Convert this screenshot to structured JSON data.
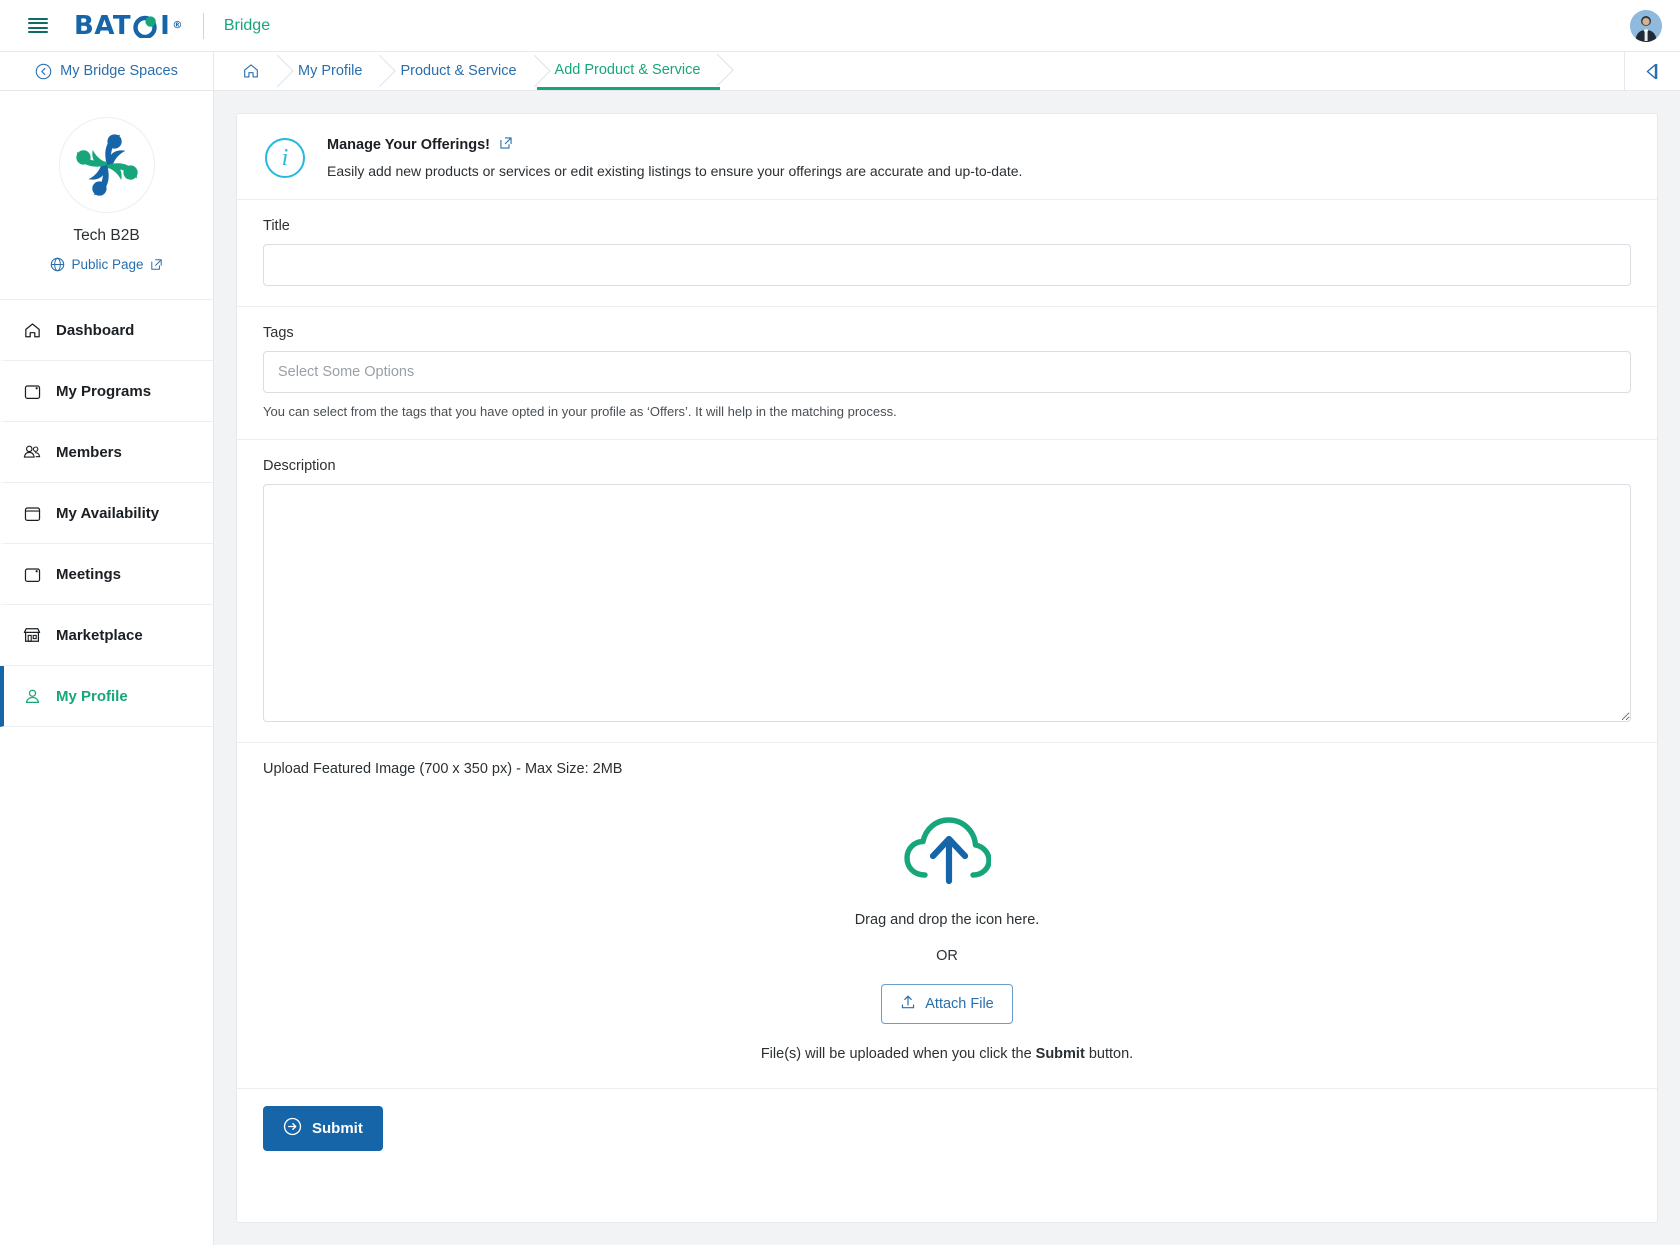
{
  "topbar": {
    "menu_icon": "hamburger-icon",
    "logo_text": "BAT",
    "logo_text_tail": "I",
    "logo_reg": "®",
    "product": "Bridge",
    "avatar_alt": "user-avatar"
  },
  "breadcrumb": {
    "back_label": "My Bridge Spaces",
    "home_icon": "home-icon",
    "items": [
      {
        "label": "My Profile",
        "active": false
      },
      {
        "label": "Product & Service",
        "active": false
      },
      {
        "label": "Add Product & Service",
        "active": true
      }
    ],
    "collapse_icon": "collapse-left-icon"
  },
  "sidebar": {
    "space_name": "Tech B2B",
    "public_page_label": "Public Page",
    "items": [
      {
        "label": "Dashboard",
        "icon": "home-icon",
        "active": false
      },
      {
        "label": "My Programs",
        "icon": "calendar-icon",
        "active": false
      },
      {
        "label": "Members",
        "icon": "users-icon",
        "active": false
      },
      {
        "label": "My Availability",
        "icon": "calendar-icon",
        "active": false
      },
      {
        "label": "Meetings",
        "icon": "calendar-icon",
        "active": false
      },
      {
        "label": "Marketplace",
        "icon": "store-icon",
        "active": false
      },
      {
        "label": "My Profile",
        "icon": "user-icon",
        "active": true
      }
    ]
  },
  "info_banner": {
    "icon": "info-circle-icon",
    "title": "Manage Your Offerings!",
    "external_icon": "external-link-icon",
    "description": "Easily add new products or services or edit existing listings to ensure your offerings are accurate and up-to-date."
  },
  "form": {
    "title_label": "Title",
    "title_value": "",
    "title_placeholder": "",
    "tags_label": "Tags",
    "tags_value": "",
    "tags_placeholder": "Select Some Options",
    "tags_help": "You can select from the tags that you have opted in your profile as ‘Offers’. It will help in the matching process.",
    "description_label": "Description",
    "description_value": "",
    "description_placeholder": ""
  },
  "upload": {
    "label": "Upload Featured Image (700 x 350 px) - Max Size: 2MB",
    "cloud_icon": "cloud-upload-icon",
    "drag_text": "Drag and drop the icon here.",
    "or_text": "OR",
    "attach_label": "Attach File",
    "attach_icon": "upload-icon",
    "note_prefix": "File(s) will be uploaded when you click the ",
    "note_bold": "Submit",
    "note_suffix": " button."
  },
  "actions": {
    "submit_label": "Submit",
    "submit_icon": "arrow-right-circle-icon"
  },
  "colors": {
    "brand_blue": "#1565a8",
    "brand_green": "#17a67c",
    "info_cyan": "#25b9e0",
    "page_bg": "#f2f3f5",
    "border": "#e6e8eb"
  }
}
